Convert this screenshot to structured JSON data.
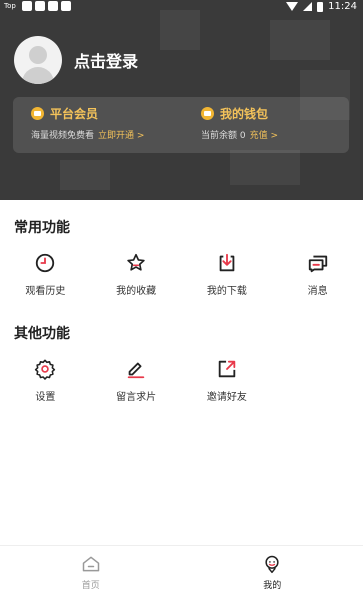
{
  "status_bar": {
    "app_tag": "Top",
    "time": "11:24"
  },
  "profile": {
    "login_text": "点击登录"
  },
  "vip_card": {
    "membership": {
      "title": "平台会员",
      "subtitle": "海量视频免费看",
      "link": "立即开通 >"
    },
    "wallet": {
      "title": "我的钱包",
      "subtitle": "当前余额 0",
      "link": "充值 >"
    }
  },
  "common": {
    "title": "常用功能",
    "items": [
      {
        "label": "观看历史",
        "icon": "clock-icon"
      },
      {
        "label": "我的收藏",
        "icon": "star-icon"
      },
      {
        "label": "我的下载",
        "icon": "download-icon"
      },
      {
        "label": "消息",
        "icon": "message-icon"
      }
    ]
  },
  "other": {
    "title": "其他功能",
    "items": [
      {
        "label": "设置",
        "icon": "gear-icon"
      },
      {
        "label": "留言求片",
        "icon": "pen-icon"
      },
      {
        "label": "邀请好友",
        "icon": "share-icon"
      }
    ]
  },
  "bottom_nav": {
    "items": [
      {
        "label": "首页",
        "icon": "home-icon",
        "active": false
      },
      {
        "label": "我的",
        "icon": "profile-icon",
        "active": true
      }
    ]
  },
  "colors": {
    "accent": "#e8394a",
    "gold": "#f3c25a",
    "header_bg": "#3a3a3a"
  }
}
